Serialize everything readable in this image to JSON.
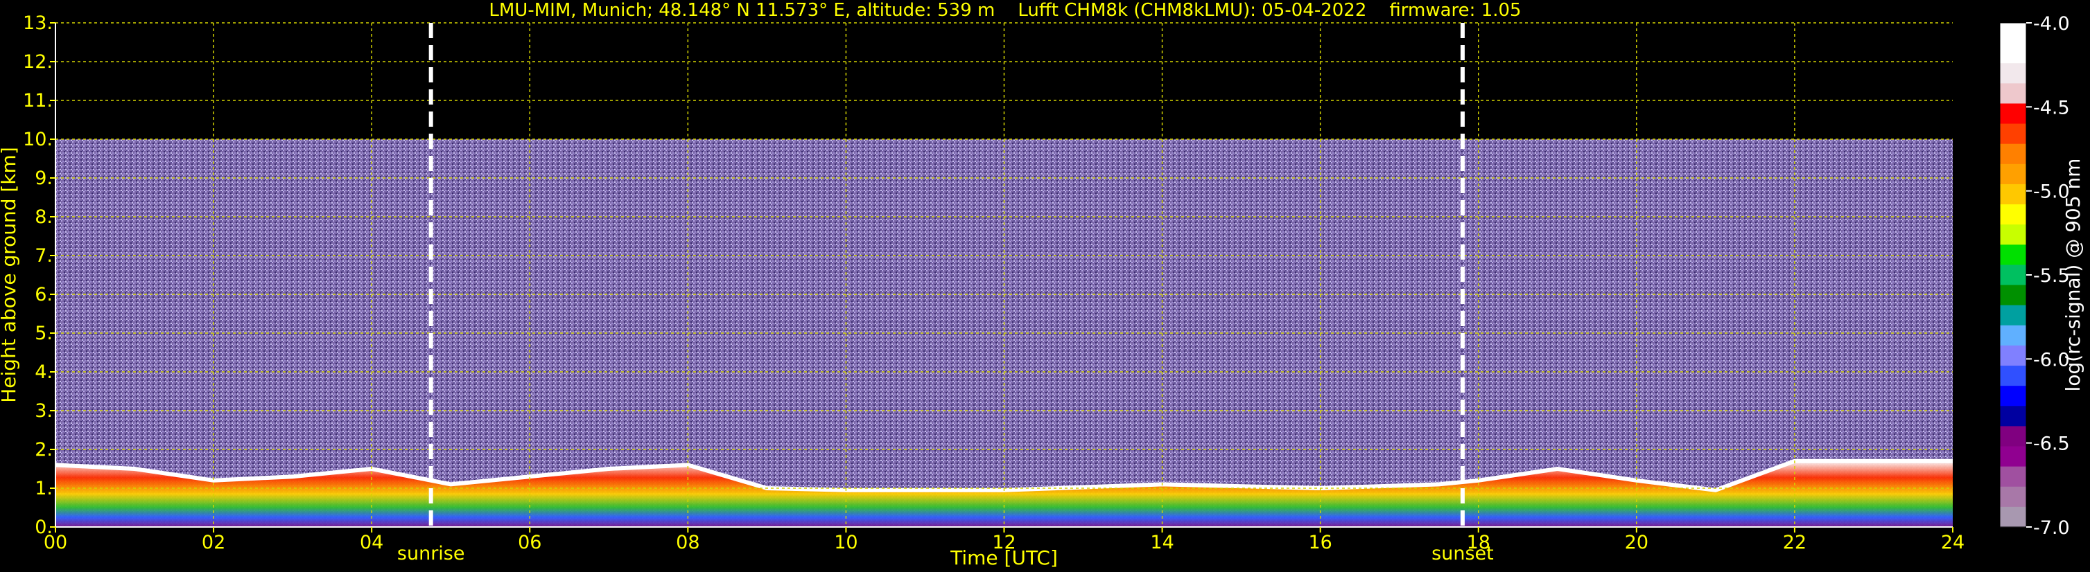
{
  "chart_data": {
    "type": "heatmap",
    "title": "LMU-MIM, Munich; 48.148° N 11.573° E, altitude: 539 m    Lufft CHM8k (CHM8kLMU): 05-04-2022    firmware: 1.05",
    "xlabel": "Time [UTC]",
    "ylabel": "Height above ground [km]",
    "xlim": [
      0,
      24
    ],
    "ylim": [
      0,
      13
    ],
    "x_ticks": [
      "00",
      "02",
      "04",
      "06",
      "08",
      "10",
      "12",
      "14",
      "16",
      "18",
      "20",
      "22",
      "24"
    ],
    "x_tick_values": [
      0,
      2,
      4,
      6,
      8,
      10,
      12,
      14,
      16,
      18,
      20,
      22,
      24
    ],
    "y_ticks": [
      "0.",
      "1.",
      "2.",
      "3.",
      "4.",
      "5.",
      "6.",
      "7.",
      "8.",
      "9.",
      "10.",
      "11.",
      "12.",
      "13."
    ],
    "y_tick_values": [
      0,
      1,
      2,
      3,
      4,
      5,
      6,
      7,
      8,
      9,
      10,
      11,
      12,
      13
    ],
    "grid": true,
    "grid_color": "#d4d400",
    "measurement_ceiling_km": 10,
    "markers": [
      {
        "label": "sunrise",
        "time": 4.75
      },
      {
        "label": "sunset",
        "time": 17.8
      }
    ],
    "mixing_layer_top_km": [
      [
        0,
        1.6
      ],
      [
        1,
        1.5
      ],
      [
        2,
        1.2
      ],
      [
        3,
        1.3
      ],
      [
        4,
        1.5
      ],
      [
        5,
        1.1
      ],
      [
        6,
        1.3
      ],
      [
        7,
        1.5
      ],
      [
        8,
        1.6
      ],
      [
        9,
        1.0
      ],
      [
        10,
        0.95
      ],
      [
        12,
        0.95
      ],
      [
        14,
        1.1
      ],
      [
        16,
        1.0
      ],
      [
        17.5,
        1.1
      ],
      [
        18,
        1.2
      ],
      [
        19,
        1.5
      ],
      [
        20,
        1.2
      ],
      [
        21,
        0.95
      ],
      [
        22,
        1.7
      ],
      [
        24,
        1.7
      ]
    ],
    "colorbar": {
      "label": "log(rc-signal) @ 905 nm",
      "min": -7.0,
      "max": -4.0,
      "ticks": [
        "-4.0",
        "-4.5",
        "-5.0",
        "-5.5",
        "-6.0",
        "-6.5",
        "-7.0"
      ],
      "tick_values": [
        -4.0,
        -4.5,
        -5.0,
        -5.5,
        -6.0,
        -6.5,
        -7.0
      ],
      "colors": [
        "#ffffff",
        "#ffffff",
        "#f2e8ec",
        "#eec8cc",
        "#ff0000",
        "#ff4000",
        "#ff8000",
        "#ffa000",
        "#ffc800",
        "#ffff00",
        "#c8ff00",
        "#00e000",
        "#00c060",
        "#009000",
        "#00a0a0",
        "#60b0ff",
        "#8080ff",
        "#3050ff",
        "#0000ff",
        "#0000a0",
        "#800080",
        "#900090",
        "#a050a0",
        "#a878a8",
        "#a898b0"
      ]
    }
  }
}
